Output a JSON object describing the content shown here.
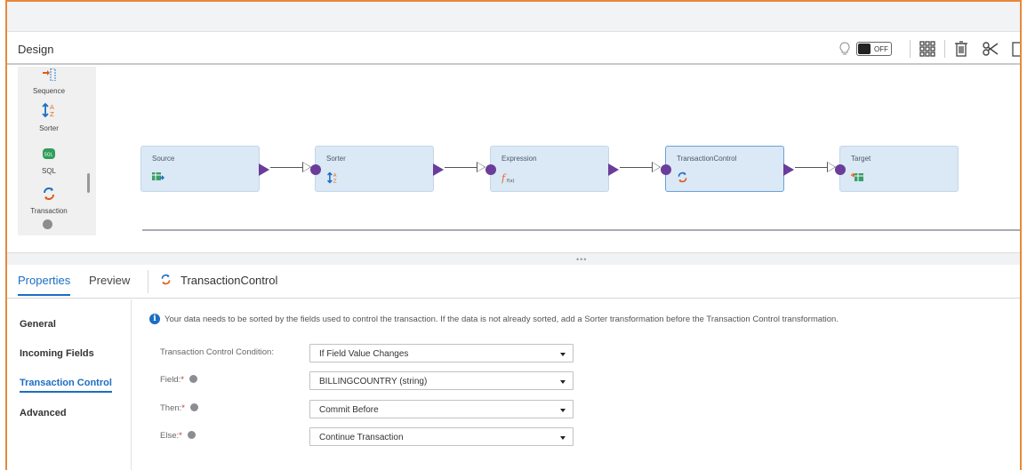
{
  "header": {
    "title": "Design",
    "toggle_label": "OFF",
    "icons": [
      "lightbulb-icon",
      "grid-icon",
      "trash-icon",
      "scissors-icon",
      "copy-icon"
    ]
  },
  "palette": {
    "items": [
      {
        "label": "Sequence",
        "icon": "sequence-icon"
      },
      {
        "label": "Sorter",
        "icon": "sorter-icon"
      },
      {
        "label": "SQL",
        "icon": "sql-icon",
        "icon_text": "SQL"
      },
      {
        "label": "Transaction",
        "icon": "transaction-icon"
      }
    ]
  },
  "nodes": [
    {
      "label": "Source",
      "icon": "source-icon"
    },
    {
      "label": "Sorter",
      "icon": "sorter-icon"
    },
    {
      "label": "Expression",
      "icon": "expression-icon",
      "icon_text": "f(x)"
    },
    {
      "label": "TransactionControl",
      "icon": "transaction-icon"
    },
    {
      "label": "Target",
      "icon": "target-icon"
    }
  ],
  "tabs": {
    "properties": "Properties",
    "preview": "Preview",
    "object_name": "TransactionControl"
  },
  "sidebar": {
    "items": [
      {
        "label": "General"
      },
      {
        "label": "Incoming Fields"
      },
      {
        "label": "Transaction Control"
      },
      {
        "label": "Advanced"
      }
    ]
  },
  "content": {
    "info_text": "Your data needs to be sorted by the fields used to control the transaction. If the data is not already sorted, add a Sorter transformation before the Transaction Control transformation.",
    "fields": [
      {
        "label": "Transaction Control Condition:",
        "value": "If Field Value Changes",
        "required": false
      },
      {
        "label": "Field:",
        "value": "BILLINGCOUNTRY (string)",
        "required": true
      },
      {
        "label": "Then:",
        "value": "Commit Before",
        "required": true
      },
      {
        "label": "Else:",
        "value": "Continue Transaction",
        "required": true
      }
    ]
  },
  "colors": {
    "accent": "#1c6ec3",
    "node_bg": "#dbe8f5",
    "port": "#6a3d9a",
    "frame": "#e8883a"
  }
}
